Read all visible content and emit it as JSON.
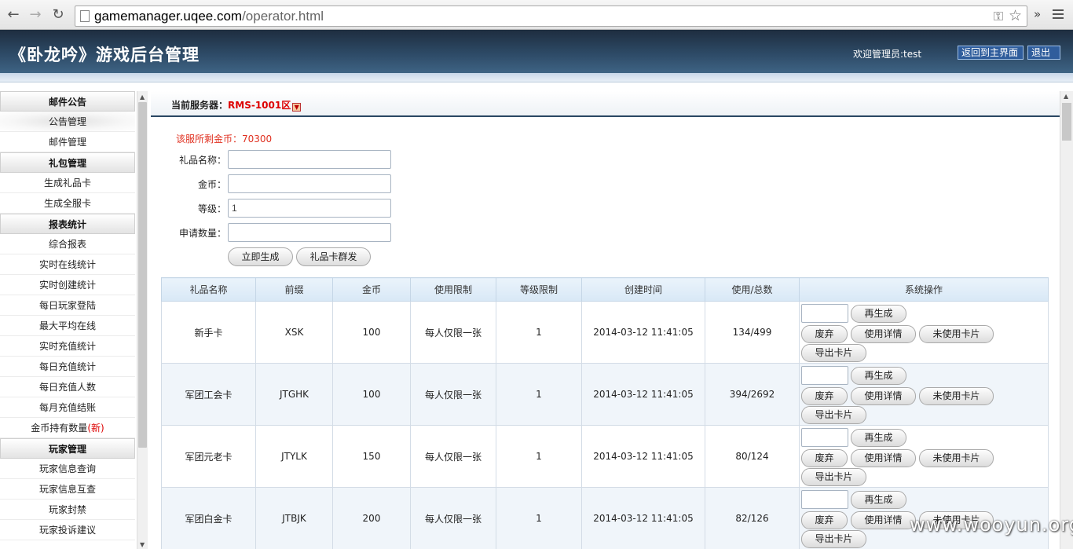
{
  "browser": {
    "url_host": "gamemanager.uqee.com",
    "url_path": "/operator.html"
  },
  "header": {
    "title": "《卧龙吟》游戏后台管理",
    "welcome": "欢迎管理员:test",
    "back_label": "返回到主界面",
    "logout_label": "退出"
  },
  "sidebar": {
    "sections": [
      {
        "title": "邮件公告",
        "items": [
          "公告管理",
          "邮件管理"
        ]
      },
      {
        "title": "礼包管理",
        "items": [
          "生成礼品卡",
          "生成全服卡"
        ]
      },
      {
        "title": "报表统计",
        "items": [
          "综合报表",
          "实时在线统计",
          "实时创建统计",
          "每日玩家登陆",
          "最大平均在线",
          "实时充值统计",
          "每日充值统计",
          "每日充值人数",
          "每月充值结账",
          "金币持有数量"
        ]
      },
      {
        "title": "玩家管理",
        "items": [
          "玩家信息查询",
          "玩家信息互查",
          "玩家封禁",
          "玩家投诉建议"
        ]
      }
    ],
    "new_tag": "(新)"
  },
  "main": {
    "server_label": "当前服务器：",
    "server_value": "RMS-1001区",
    "coins_text": "该服所剩金币：70300",
    "form": {
      "gift_name_label": "礼品名称：",
      "gift_name_value": "",
      "gold_label": "金币：",
      "gold_value": "",
      "level_label": "等级：",
      "level_value": "1",
      "qty_label": "申请数量：",
      "qty_value": ""
    },
    "generate_label": "立即生成",
    "mass_send_label": "礼品卡群发"
  },
  "table": {
    "headers": [
      "礼品名称",
      "前缀",
      "金币",
      "使用限制",
      "等级限制",
      "创建时间",
      "使用/总数",
      "系统操作"
    ],
    "rows": [
      {
        "name": "新手卡",
        "prefix": "XSK",
        "gold": "100",
        "limit": "每人仅限一张",
        "level": "1",
        "created": "2014-03-12 11:41:05",
        "usage": "134/499"
      },
      {
        "name": "军团工会卡",
        "prefix": "JTGHK",
        "gold": "100",
        "limit": "每人仅限一张",
        "level": "1",
        "created": "2014-03-12 11:41:05",
        "usage": "394/2692"
      },
      {
        "name": "军团元老卡",
        "prefix": "JTYLK",
        "gold": "150",
        "limit": "每人仅限一张",
        "level": "1",
        "created": "2014-03-12 11:41:05",
        "usage": "80/124"
      },
      {
        "name": "军团白金卡",
        "prefix": "JTBJK",
        "gold": "200",
        "limit": "每人仅限一张",
        "level": "1",
        "created": "2014-03-12 11:41:05",
        "usage": "82/126"
      }
    ],
    "ops": {
      "regen": "再生成",
      "void": "废弃",
      "detail": "使用详情",
      "unused": "未使用卡片",
      "export": "导出卡片"
    }
  },
  "watermark": "www.wooyun.org"
}
